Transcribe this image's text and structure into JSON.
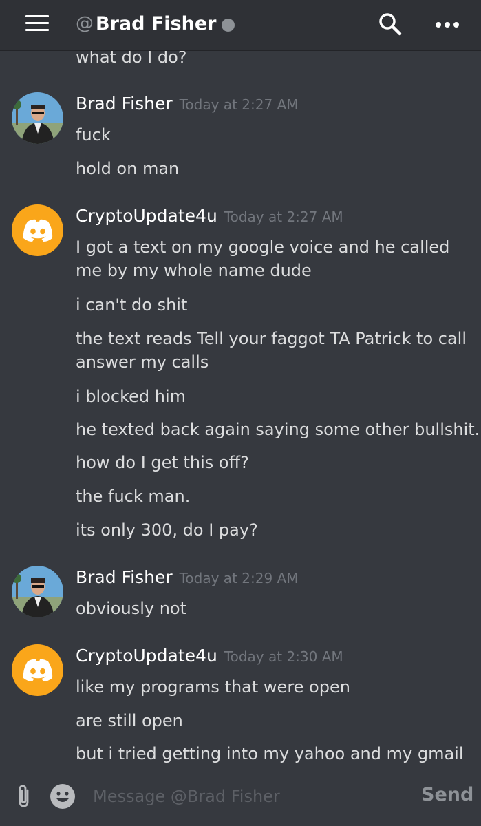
{
  "header": {
    "at_sign": "@",
    "recipient_name": "Brad Fisher",
    "status_color": "#8e9297"
  },
  "icons": {
    "menu": "hamburger-menu-icon",
    "search": "search-icon",
    "more": "more-options-icon",
    "attach": "paperclip-icon",
    "emoji": "emoji-icon",
    "discord_avatar": "discord-logo-icon"
  },
  "colors": {
    "background": "#36393f",
    "header_bg": "#2f3136",
    "discord_avatar_bg": "#faa61a",
    "timestamp": "#72767d"
  },
  "messages": {
    "partial_line": "what do I do?",
    "group_1": {
      "author": "Brad Fisher",
      "timestamp": "Today at 2:27 AM",
      "lines": [
        "fuck",
        "hold on man"
      ]
    },
    "group_2": {
      "author": "CryptoUpdate4u",
      "timestamp": "Today at 2:27 AM",
      "lines": [
        "I got a text on my google voice and he called me by my whole name dude",
        "i can't do shit",
        "the text reads Tell your faggot TA Patrick to call answer my calls",
        "i blocked him",
        "he texted back again saying some other bullshit.",
        "how do I get this off?",
        "the fuck man.",
        "its only 300, do I pay?"
      ]
    },
    "group_3": {
      "author": "Brad Fisher",
      "timestamp": "Today at 2:29 AM",
      "lines": [
        "obviously not"
      ]
    },
    "group_4": {
      "author": "CryptoUpdate4u",
      "timestamp": "Today at 2:30 AM",
      "lines": [
        "like my programs that were open",
        "are still open",
        "but i tried getting into my yahoo and my gmail"
      ]
    }
  },
  "composer": {
    "placeholder": "Message @Brad Fisher",
    "send_label": "Send"
  }
}
